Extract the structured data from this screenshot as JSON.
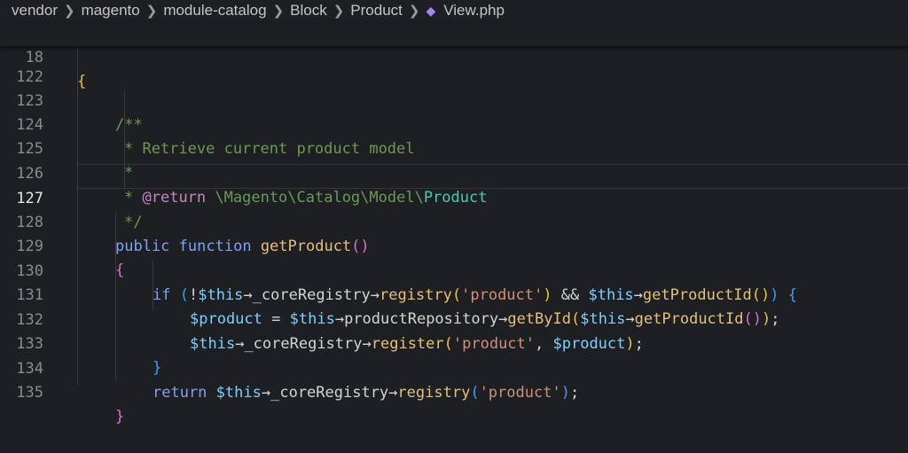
{
  "breadcrumb": {
    "items": [
      "vendor",
      "magento",
      "module-catalog",
      "Block",
      "Product"
    ],
    "file": "View.php"
  },
  "sticky": {
    "line_number": "18",
    "code": "{"
  },
  "lines": [
    {
      "n": "122"
    },
    {
      "n": "123"
    },
    {
      "n": "124"
    },
    {
      "n": "125"
    },
    {
      "n": "126"
    },
    {
      "n": "127"
    },
    {
      "n": "128"
    },
    {
      "n": "129"
    },
    {
      "n": "130"
    },
    {
      "n": "131"
    },
    {
      "n": "132"
    },
    {
      "n": "133"
    },
    {
      "n": "134"
    },
    {
      "n": "135"
    }
  ],
  "code": {
    "l123": "/**",
    "l124": "* Retrieve current product model",
    "l125": "*",
    "l126_tag": "@return",
    "l126_path": "\\Magento\\Catalog\\Model\\",
    "l126_cls": "Product",
    "l127": "*/",
    "public": "public",
    "function": "function",
    "getProduct": "getProduct",
    "if": "if",
    "not": "!",
    "this": "$this",
    "arrow": "→",
    "coreRegistry": "_coreRegistry",
    "registry": "registry",
    "product_str": "'product'",
    "and": "&&",
    "getProductId": "getProductId",
    "product_var": "$product",
    "eq": "=",
    "productRepository": "productRepository",
    "getById": "getById",
    "register": "register",
    "return": "return"
  },
  "colors": {
    "background": "#1e1f22",
    "comment": "#6a9955",
    "keyword": "#7aa2f7",
    "function": "#e5c07b",
    "variable": "#7dcfff",
    "string": "#ce9178",
    "file_icon": "#a586ff"
  },
  "icons": {
    "file_icon": "php-elephant-icon",
    "separator": "chevron-right-icon"
  }
}
